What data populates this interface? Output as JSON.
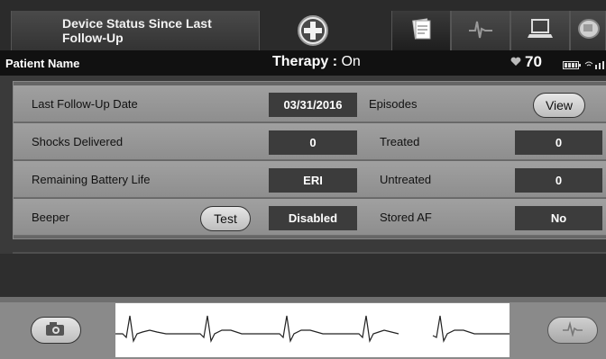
{
  "header": {
    "title": "Device Status Since Last Follow-Up",
    "add_icon": "plus-circle-icon",
    "tabs": [
      {
        "icon": "notes-icon",
        "active": true
      },
      {
        "icon": "ecg-waveform-icon",
        "active": false
      },
      {
        "icon": "laptop-icon",
        "active": false
      },
      {
        "icon": "device-icon",
        "active": false
      }
    ]
  },
  "patient_bar": {
    "patient_label": "Patient Name",
    "therapy_label": "Therapy : ",
    "therapy_value": "On",
    "heart_rate": "70",
    "heart_icon": "heart-icon",
    "battery_icon": "battery-icon",
    "signal_icon": "signal-icon"
  },
  "status": {
    "last_followup_label": "Last Follow-Up Date",
    "last_followup_value": "03/31/2016",
    "episodes_label": "Episodes",
    "view_button": "View",
    "shocks_label": "Shocks Delivered",
    "shocks_value": "0",
    "treated_label": "Treated",
    "treated_value": "0",
    "battery_label": "Remaining Battery Life",
    "battery_value": "ERI",
    "untreated_label": "Untreated",
    "untreated_value": "0",
    "beeper_label": "Beeper",
    "test_button": "Test",
    "beeper_value": "Disabled",
    "stored_af_label": "Stored AF",
    "stored_af_value": "No"
  },
  "bottom": {
    "snapshot_icon": "camera-icon",
    "ecg_icon": "ecg-waveform-icon"
  }
}
